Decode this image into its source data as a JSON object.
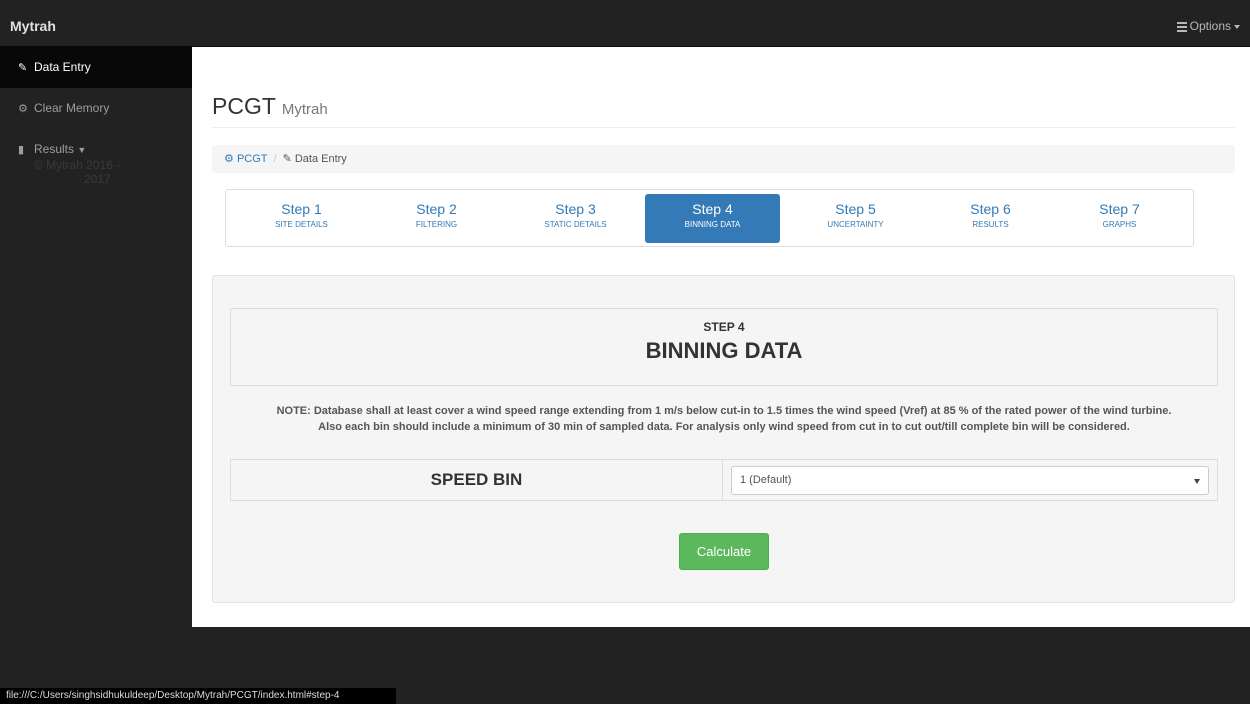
{
  "navbar": {
    "brand": "Mytrah",
    "options_label": "Options"
  },
  "sidebar": {
    "items": [
      {
        "label": "Data Entry",
        "icon": "edit-icon",
        "active": true
      },
      {
        "label": "Clear Memory",
        "icon": "dashboard-icon",
        "active": false
      },
      {
        "label": "Results",
        "icon": "book-icon",
        "active": false
      }
    ],
    "copyright_line1": "© Mytrah    2016 -",
    "copyright_line2": "2017"
  },
  "page": {
    "title": "PCGT",
    "subtitle": "Mytrah"
  },
  "breadcrumb": {
    "root": "PCGT",
    "current": "Data Entry"
  },
  "steps": [
    {
      "num": "Step 1",
      "label": "SITE DETAILS",
      "active": false
    },
    {
      "num": "Step 2",
      "label": "FILTERING",
      "active": false
    },
    {
      "num": "Step 3",
      "label": "STATIC DETAILS",
      "active": false
    },
    {
      "num": "Step 4",
      "label": "BINNING DATA",
      "active": true
    },
    {
      "num": "Step 5",
      "label": "UNCERTAINTY",
      "active": false
    },
    {
      "num": "Step 6",
      "label": "RESULTS",
      "active": false
    },
    {
      "num": "Step 7",
      "label": "GRAPHS",
      "active": false
    }
  ],
  "section": {
    "step_label": "STEP 4",
    "title": "BINNING DATA",
    "note_line1": "NOTE: Database shall at least cover a wind speed range extending from 1 m/s below cut-in to 1.5 times the wind speed (Vref) at 85 % of the rated power of the wind turbine.",
    "note_line2": "Also each bin should include a minimum of 30 min of sampled data. For analysis only wind speed from cut in to cut out/till complete bin will be considered.",
    "speed_bin_label": "SPEED BIN",
    "speed_bin_value": "1 (Default)",
    "calculate_label": "Calculate"
  },
  "statusbar": {
    "url": "file:///C:/Users/singhsidhukuldeep/Desktop/Mytrah/PCGT/index.html#step-4"
  },
  "colors": {
    "navbar": "#222222",
    "primary": "#337ab7",
    "success": "#5cb85c"
  }
}
